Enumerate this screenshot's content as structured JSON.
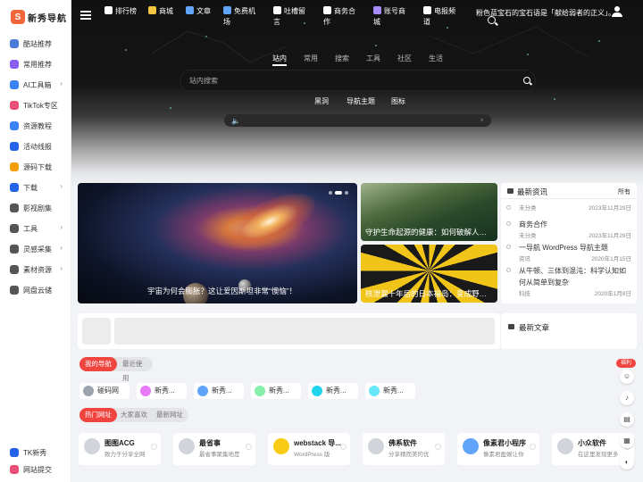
{
  "brand": {
    "name": "新秀导航",
    "mark": "S"
  },
  "sidebar": {
    "items": [
      {
        "label": "酷站推荐",
        "color": "#4a7bd8",
        "arrow": false
      },
      {
        "label": "常用推荐",
        "color": "#8b5cf6",
        "arrow": false
      },
      {
        "label": "AI工具箱",
        "color": "#3b82f6",
        "arrow": true
      },
      {
        "label": "TikTok专区",
        "color": "#e94e77",
        "arrow": false
      },
      {
        "label": "资源教程",
        "color": "#3b82f6",
        "arrow": false
      },
      {
        "label": "活动线报",
        "color": "#2563eb",
        "arrow": false
      },
      {
        "label": "源码下载",
        "color": "#f59e0b",
        "arrow": false
      },
      {
        "label": "下载",
        "color": "#2563eb",
        "arrow": true
      },
      {
        "label": "影视剧集",
        "color": "#555",
        "arrow": false
      },
      {
        "label": "工具",
        "color": "#555",
        "arrow": true
      },
      {
        "label": "灵感采集",
        "color": "#555",
        "arrow": true
      },
      {
        "label": "素材资源",
        "color": "#555",
        "arrow": true
      },
      {
        "label": "网盘云储",
        "color": "#555",
        "arrow": false
      }
    ],
    "bottom": [
      {
        "label": "TK新秀",
        "color": "#2563eb"
      },
      {
        "label": "网站提交",
        "color": "#e94e77"
      }
    ]
  },
  "topnav": [
    {
      "label": "排行榜",
      "color": "#ffffff"
    },
    {
      "label": "商城",
      "color": "#f5c542"
    },
    {
      "label": "文章",
      "color": "#60a5fa"
    },
    {
      "label": "免费机场",
      "color": "#60a5fa"
    },
    {
      "label": "吐槽留言",
      "color": "#ffffff"
    },
    {
      "label": "商务合作",
      "color": "#ffffff"
    },
    {
      "label": "账号商城",
      "color": "#a78bfa"
    },
    {
      "label": "电报频道",
      "color": "#ffffff"
    }
  ],
  "slogan": "粉色蓝宝石的宝石语是「献给弱者的正义」。",
  "search": {
    "tabs": [
      "站内",
      "常用",
      "搜索",
      "工具",
      "社区",
      "生活"
    ],
    "active_tab": "站内",
    "placeholder": "站内搜索",
    "quick_links": [
      "黑洞",
      "导航主题",
      "图标"
    ]
  },
  "player": {
    "speaker": "🔈",
    "close": "×"
  },
  "banner": {
    "caption": "宇宙为何会膨胀？这让爱因斯坦非常“懊恼”！",
    "slides": 3,
    "active_slide": 1
  },
  "tiles": [
    {
      "caption": "守护生命起源的健康：如何破解人类..."
    },
    {
      "caption": "核泄漏十年后的日本福岛：变成野生..."
    }
  ],
  "news": {
    "title": "最新资讯",
    "all_label": "所有",
    "items": [
      {
        "title": "",
        "category": "未分类",
        "date": "2023年11月29日"
      },
      {
        "title": "商务合作",
        "category": "未分类",
        "date": "2023年11月29日"
      },
      {
        "title": "一导航 WordPress 导航主题",
        "category": "资讯",
        "date": "2020年1月15日"
      },
      {
        "title": "从牛顿、三体到混沌：科学认知如何从简单到复杂",
        "category": "科技",
        "date": "2020年1月8日"
      }
    ]
  },
  "articles": {
    "title": "最新文章"
  },
  "mynav": {
    "tabs": [
      "我的导航",
      "最近使用"
    ],
    "active": "我的导航"
  },
  "chips": [
    {
      "label": "碰码网",
      "color": "#9ca3af"
    },
    {
      "label": "新秀...",
      "color": "#e879f9"
    },
    {
      "label": "新秀...",
      "color": "#60a5fa"
    },
    {
      "label": "新秀...",
      "color": "#86efac"
    },
    {
      "label": "新秀...",
      "color": "#22d3ee"
    },
    {
      "label": "新秀...",
      "color": "#67e8f9"
    }
  ],
  "hot": {
    "tabs": [
      "热门网址",
      "大家喜欢",
      "最新网址"
    ],
    "active": "热门网址"
  },
  "sites": [
    {
      "name": "图图ACG",
      "desc": "致力于分享全网",
      "color": "#d1d5db"
    },
    {
      "name": "最省事",
      "desc": "最省事聚集地是",
      "color": "#d1d5db"
    },
    {
      "name": "webstack 导...",
      "desc": "WordPress 版",
      "color": "#facc15"
    },
    {
      "name": "佛系软件",
      "desc": "分享精而美的优",
      "color": "#d1d5db"
    },
    {
      "name": "像素君小程序",
      "desc": "像素君盈娱让你",
      "color": "#60a5fa"
    },
    {
      "name": "小众软件",
      "desc": "在这里发现更多",
      "color": "#d1d5db"
    }
  ],
  "side_actions": {
    "badge": "福利"
  }
}
